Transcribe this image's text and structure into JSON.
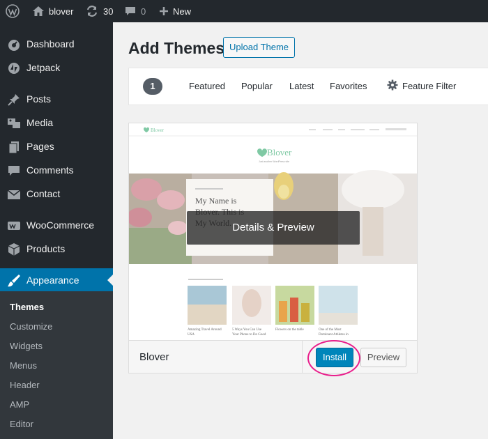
{
  "admin_bar": {
    "site_name": "blover",
    "updates_count": "30",
    "comments_count": "0",
    "new_label": "New"
  },
  "sidebar": {
    "items": [
      {
        "label": "Dashboard",
        "icon": "dashboard-icon"
      },
      {
        "label": "Jetpack",
        "icon": "jetpack-icon"
      },
      {
        "label": "Posts",
        "icon": "pin-icon"
      },
      {
        "label": "Media",
        "icon": "media-icon"
      },
      {
        "label": "Pages",
        "icon": "pages-icon"
      },
      {
        "label": "Comments",
        "icon": "comment-bubble-icon"
      },
      {
        "label": "Contact",
        "icon": "envelope-icon"
      },
      {
        "label": "WooCommerce",
        "icon": "woocommerce-icon"
      },
      {
        "label": "Products",
        "icon": "box-icon"
      },
      {
        "label": "Appearance",
        "icon": "paintbrush-icon",
        "active": true
      }
    ],
    "submenu": [
      "Themes",
      "Customize",
      "Widgets",
      "Menus",
      "Header",
      "AMP",
      "Editor"
    ]
  },
  "page": {
    "title": "Add Themes",
    "upload_button": "Upload Theme"
  },
  "filter": {
    "count": "1",
    "tabs": [
      "Featured",
      "Popular",
      "Latest",
      "Favorites"
    ],
    "feature_filter": "Feature Filter"
  },
  "theme": {
    "name": "Blover",
    "overlay": "Details & Preview",
    "install_label": "Install",
    "preview_label": "Preview",
    "screenshot": {
      "logo": "Blover",
      "tagline": "Just another WordPress site",
      "hero_text": "My Name is Blover. This is My World.",
      "posts": [
        "Amazing Travel Around USA",
        "5 Ways You Can Use Your Phone to Do Good",
        "Flowers on the table",
        "One of the Most Dominant Athletes in"
      ]
    }
  },
  "colors": {
    "admin_bg": "#23282d",
    "submenu_bg": "#32373c",
    "active_blue": "#0073aa",
    "install_blue": "#0085ba",
    "highlight_pink": "#e91e8c"
  }
}
